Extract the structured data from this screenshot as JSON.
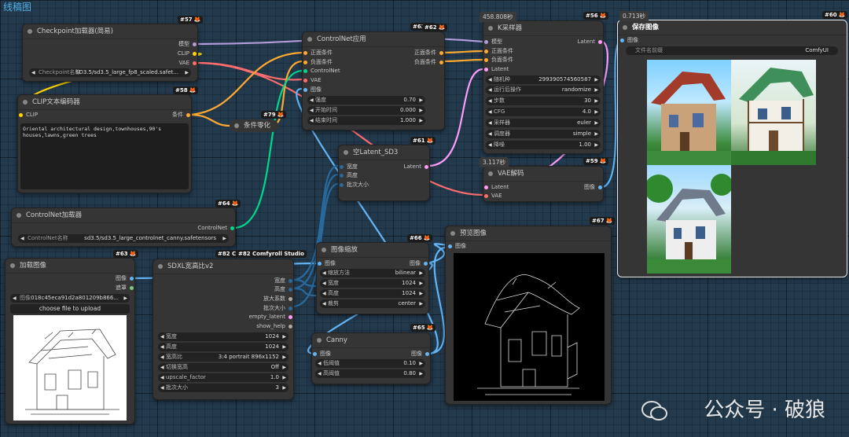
{
  "group_title": "线稿图",
  "nodes": {
    "checkpoint": {
      "badge": "#57",
      "title": "Checkpoint加载器(简易)",
      "outputs": [
        "模型",
        "CLIP",
        "VAE"
      ],
      "widget_label": "Checkpoint名称",
      "widget_value": "SD3.5/sd3.5_large_fp8_scaled.safet..."
    },
    "clip_encoder": {
      "badge": "#58",
      "title": "CLIP文本编码器",
      "input": "CLIP",
      "output": "条件",
      "text": "Oriental architectural design,townhouses,90's houses,lawns,green trees"
    },
    "cond_zero": {
      "badge": "#79",
      "title": "条件零化"
    },
    "controlnet_loader": {
      "badge": "#64",
      "title": "ControlNet加载器",
      "output": "ControlNet",
      "widget_label": "ControlNet名称",
      "widget_value": "sd3.5/sd3.5_large_controlnet_canny.safetensors"
    },
    "load_image": {
      "badge": "#63",
      "title": "加载图像",
      "outputs": [
        "图像",
        "遮罩"
      ],
      "widget_label": "图像",
      "widget_value": "018c45eca91d2a801209b866...",
      "button": "choose file to upload"
    },
    "sdxl_ratio": {
      "badge": "#82 Comfyroll Studio",
      "badge_short": "#82 Cor",
      "title": "SDXL宽高比v2",
      "outputs": [
        "宽度",
        "高度",
        "放大系数",
        "批次大小",
        "empty_latent",
        "show_help"
      ],
      "widgets": [
        [
          "宽度",
          "1024"
        ],
        [
          "高度",
          "1024"
        ],
        [
          "宽高比",
          "3:4 portrait 896x1152"
        ],
        [
          "切换宽高",
          "Off"
        ],
        [
          "upscale_factor",
          "1.0"
        ],
        [
          "批次大小",
          "3"
        ]
      ]
    },
    "controlnet_apply": {
      "badge": "#62",
      "title": "ControlNet应用",
      "inputs": [
        "正面条件",
        "负面条件",
        "ControlNet",
        "VAE",
        "图像"
      ],
      "outputs": [
        "正面条件",
        "负面条件"
      ],
      "widgets": [
        [
          "强度",
          "0.70"
        ],
        [
          "开始时间",
          "0.000"
        ],
        [
          "结束时间",
          "1.000"
        ]
      ]
    },
    "empty_latent": {
      "badge": "#61",
      "title": "空Latent_SD3",
      "inputs": [
        "宽度",
        "高度",
        "批次大小"
      ],
      "output": "Latent"
    },
    "image_scale": {
      "badge": "#66",
      "title": "图像缩放",
      "input": "图像",
      "output": "图像",
      "widgets": [
        [
          "缩放方法",
          "bilinear"
        ],
        [
          "宽度",
          "1024"
        ],
        [
          "高度",
          "1024"
        ],
        [
          "裁剪",
          "center"
        ]
      ]
    },
    "canny": {
      "badge": "#65",
      "title": "Canny",
      "input": "图像",
      "output": "图像",
      "widgets": [
        [
          "低阈值",
          "0.10"
        ],
        [
          "高阈值",
          "0.80"
        ]
      ]
    },
    "preview": {
      "badge": "#67",
      "title": "预览图像",
      "input": "图像"
    },
    "ksampler": {
      "badge": "#56",
      "timing": "458.808秒",
      "title": "K采样器",
      "inputs": [
        "模型",
        "正面条件",
        "负面条件",
        "Latent"
      ],
      "output": "Latent",
      "widgets": [
        [
          "随机种",
          "299390574560587"
        ],
        [
          "运行后操作",
          "randomize"
        ],
        [
          "步数",
          "30"
        ],
        [
          "CFG",
          "4.0"
        ],
        [
          "采样器",
          "euler"
        ],
        [
          "调度器",
          "simple"
        ],
        [
          "降噪",
          "1.00"
        ]
      ]
    },
    "vae_decode": {
      "badge": "#59",
      "timing": "3.117秒",
      "title": "VAE解码",
      "inputs": [
        "Latent",
        "VAE"
      ],
      "output": "图像"
    },
    "save_image": {
      "badge": "#60",
      "timing": "0.713秒",
      "title": "保存图像",
      "input": "图像",
      "widget_label": "文件名前缀",
      "widget_value": "ComfyUI"
    }
  },
  "watermark": "公众号 · 破狼",
  "colors": {
    "model": "#b39ddb",
    "clip": "#ffd500",
    "vae": "#ff6e6e",
    "conditioning": "#ffa931",
    "controlnet": "#00d78d",
    "image": "#64b5f6",
    "latent": "#ff9cf9",
    "int": "#29699c"
  }
}
